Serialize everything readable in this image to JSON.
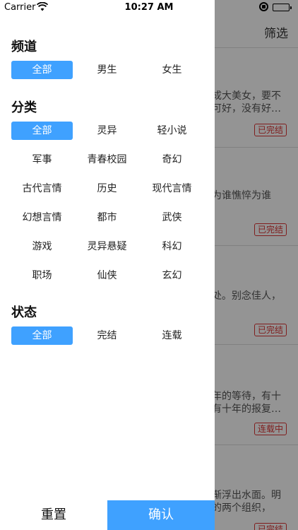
{
  "status_bar": {
    "carrier": "Carrier",
    "wifi_icon": "wifi-icon",
    "time": "10:27 AM",
    "battery_level": 1.0,
    "battery_color": "#4cd964"
  },
  "background": {
    "filter_label": "筛选",
    "cards": [
      {
        "line1": "成大美女，要不",
        "line2": "可好，没有好…",
        "tag": "已完结"
      },
      {
        "line1": "为谁憔悴为谁",
        "line2": "",
        "tag": "已完结"
      },
      {
        "line1": "处。别念佳人，",
        "line2": "",
        "tag": "已完结"
      },
      {
        "line1": "年的等待，有十",
        "line2": "有十年的报复…",
        "tag": "连载中"
      },
      {
        "line1": "渐浮出水面。明",
        "line2": "的两个组织，",
        "tag": "已完结"
      }
    ]
  },
  "drawer": {
    "accent_color": "#3fa1ff",
    "channel": {
      "title": "频道",
      "options": [
        "全部",
        "男生",
        "女生"
      ],
      "selected": "全部"
    },
    "category": {
      "title": "分类",
      "options": [
        "全部",
        "灵异",
        "轻小说",
        "军事",
        "青春校园",
        "奇幻",
        "古代言情",
        "历史",
        "现代言情",
        "幻想言情",
        "都市",
        "武侠",
        "游戏",
        "灵异悬疑",
        "科幻",
        "职场",
        "仙侠",
        "玄幻"
      ],
      "selected": "全部"
    },
    "status": {
      "title": "状态",
      "options": [
        "全部",
        "完结",
        "连载"
      ],
      "selected": "全部"
    },
    "reset_label": "重置",
    "confirm_label": "确认"
  }
}
